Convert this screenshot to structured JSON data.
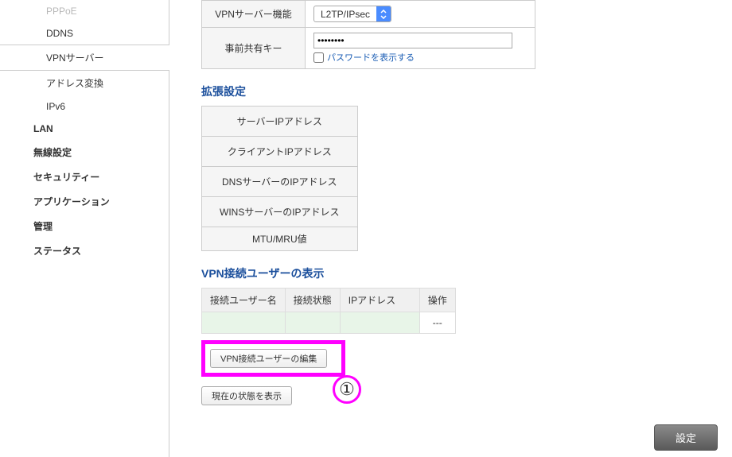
{
  "sidebar": {
    "items": [
      {
        "label": "PPPoE",
        "level": 2
      },
      {
        "label": "DDNS",
        "level": 2
      },
      {
        "label": "VPNサーバー",
        "level": 2,
        "active": true
      },
      {
        "label": "アドレス変換",
        "level": 2
      },
      {
        "label": "IPv6",
        "level": 2
      },
      {
        "label": "LAN",
        "level": 1
      },
      {
        "label": "無線設定",
        "level": 1
      },
      {
        "label": "セキュリティー",
        "level": 1
      },
      {
        "label": "アプリケーション",
        "level": 1
      },
      {
        "label": "管理",
        "level": 1
      },
      {
        "label": "ステータス",
        "level": 1
      }
    ]
  },
  "vpn": {
    "server_func_label": "VPNサーバー機能",
    "server_func_value": "L2TP/IPsec",
    "psk_label": "事前共有キー",
    "psk_value": "••••••••",
    "show_pw_label": "パスワードを表示する"
  },
  "ext": {
    "title": "拡張設定",
    "rows": [
      "サーバーIPアドレス",
      "クライアントIPアドレス",
      "DNSサーバーのIPアドレス",
      "WINSサーバーのIPアドレス",
      "MTU/MRU値"
    ]
  },
  "users": {
    "title": "VPN接続ユーザーの表示",
    "headers": [
      "接続ユーザー名",
      "接続状態",
      "IPアドレス",
      "操作"
    ],
    "empty_action": "---",
    "edit_btn": "VPN接続ユーザーの編集",
    "status_btn": "現在の状態を表示"
  },
  "annotation": {
    "num": "①"
  },
  "submit": {
    "label": "設定"
  }
}
